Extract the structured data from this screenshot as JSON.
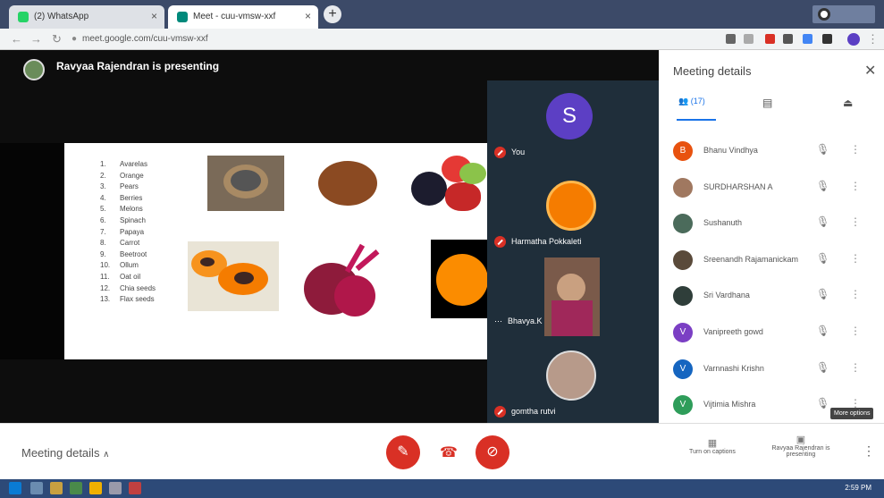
{
  "browser": {
    "tabs": [
      {
        "title": "(2) WhatsApp",
        "icon": "whatsapp-icon",
        "color": "#25d366"
      },
      {
        "title": "Meet - cuu-vmsw-xxf",
        "icon": "meet-icon",
        "color": "#00897b"
      }
    ],
    "url": "meet.google.com/cuu-vmsw-xxf"
  },
  "stage": {
    "presenter_text": "Ravyaa Rajendran is presenting",
    "slide_list": [
      {
        "num": "1.",
        "item": "Avarelas"
      },
      {
        "num": "2.",
        "item": "Orange"
      },
      {
        "num": "3.",
        "item": "Pears"
      },
      {
        "num": "4.",
        "item": "Berries"
      },
      {
        "num": "5.",
        "item": "Melons"
      },
      {
        "num": "6.",
        "item": "Spinach"
      },
      {
        "num": "7.",
        "item": "Papaya"
      },
      {
        "num": "8.",
        "item": "Carrot"
      },
      {
        "num": "9.",
        "item": "Beetroot"
      },
      {
        "num": "10.",
        "item": "Ollum"
      },
      {
        "num": "11.",
        "item": "Oat oil"
      },
      {
        "num": "12.",
        "item": "Chia seeds"
      },
      {
        "num": "13.",
        "item": "Flax seeds"
      }
    ]
  },
  "tiles": [
    {
      "name": "You",
      "initial": "S",
      "color": "#5c3fc4"
    },
    {
      "name": "Harmatha Pokkaleti"
    },
    {
      "name": "Bhavya.K"
    },
    {
      "name": "gomtha rutvi"
    }
  ],
  "panel": {
    "title": "Meeting details",
    "people_count": "(17)",
    "participants": [
      {
        "name": "Bhanu Vindhya",
        "initial": "B",
        "color": "#e8520f"
      },
      {
        "name": "SURDHARSHAN A",
        "initial": "",
        "color": "#a07860"
      },
      {
        "name": "Sushanuth",
        "initial": "",
        "color": "#4b6b5b"
      },
      {
        "name": "Sreenandh Rajamanickam",
        "initial": "",
        "color": "#5a4a3a"
      },
      {
        "name": "Sri Vardhana",
        "initial": "",
        "color": "#2f3e3a"
      },
      {
        "name": "Vanipreeth gowd",
        "initial": "V",
        "color": "#7b3fc4"
      },
      {
        "name": "Varnnashi Krishn",
        "initial": "V",
        "color": "#1565c0"
      },
      {
        "name": "Vijtimia Mishra",
        "initial": "V",
        "color": "#2e9d5a"
      }
    ],
    "tooltip": "More options"
  },
  "bottom": {
    "meeting_details": "Meeting details",
    "caption_label": "Turn on captions",
    "present_label": "Ravyaa Rajendran is presenting"
  },
  "taskbar": {
    "time": "2:59 PM"
  }
}
